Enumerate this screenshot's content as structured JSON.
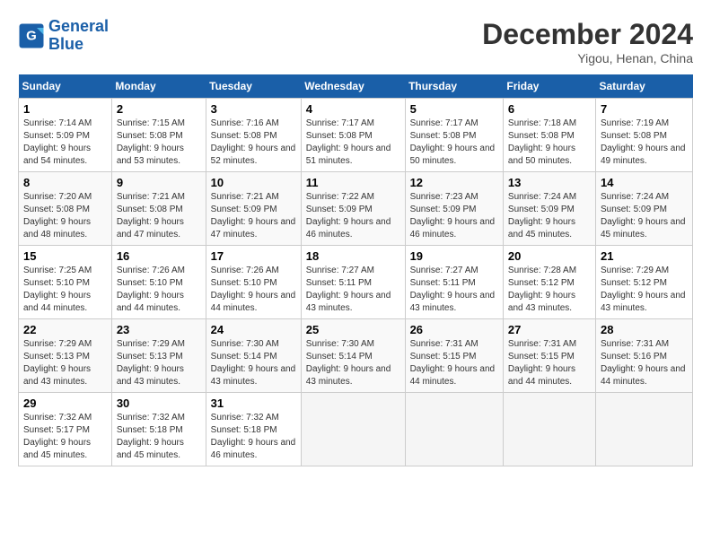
{
  "logo": {
    "text_general": "General",
    "text_blue": "Blue"
  },
  "header": {
    "month": "December 2024",
    "location": "Yigou, Henan, China"
  },
  "weekdays": [
    "Sunday",
    "Monday",
    "Tuesday",
    "Wednesday",
    "Thursday",
    "Friday",
    "Saturday"
  ],
  "weeks": [
    [
      {
        "day": "1",
        "sunrise": "7:14 AM",
        "sunset": "5:09 PM",
        "daylight": "9 hours and 54 minutes."
      },
      {
        "day": "2",
        "sunrise": "7:15 AM",
        "sunset": "5:08 PM",
        "daylight": "9 hours and 53 minutes."
      },
      {
        "day": "3",
        "sunrise": "7:16 AM",
        "sunset": "5:08 PM",
        "daylight": "9 hours and 52 minutes."
      },
      {
        "day": "4",
        "sunrise": "7:17 AM",
        "sunset": "5:08 PM",
        "daylight": "9 hours and 51 minutes."
      },
      {
        "day": "5",
        "sunrise": "7:17 AM",
        "sunset": "5:08 PM",
        "daylight": "9 hours and 50 minutes."
      },
      {
        "day": "6",
        "sunrise": "7:18 AM",
        "sunset": "5:08 PM",
        "daylight": "9 hours and 50 minutes."
      },
      {
        "day": "7",
        "sunrise": "7:19 AM",
        "sunset": "5:08 PM",
        "daylight": "9 hours and 49 minutes."
      }
    ],
    [
      {
        "day": "8",
        "sunrise": "7:20 AM",
        "sunset": "5:08 PM",
        "daylight": "9 hours and 48 minutes."
      },
      {
        "day": "9",
        "sunrise": "7:21 AM",
        "sunset": "5:08 PM",
        "daylight": "9 hours and 47 minutes."
      },
      {
        "day": "10",
        "sunrise": "7:21 AM",
        "sunset": "5:09 PM",
        "daylight": "9 hours and 47 minutes."
      },
      {
        "day": "11",
        "sunrise": "7:22 AM",
        "sunset": "5:09 PM",
        "daylight": "9 hours and 46 minutes."
      },
      {
        "day": "12",
        "sunrise": "7:23 AM",
        "sunset": "5:09 PM",
        "daylight": "9 hours and 46 minutes."
      },
      {
        "day": "13",
        "sunrise": "7:24 AM",
        "sunset": "5:09 PM",
        "daylight": "9 hours and 45 minutes."
      },
      {
        "day": "14",
        "sunrise": "7:24 AM",
        "sunset": "5:09 PM",
        "daylight": "9 hours and 45 minutes."
      }
    ],
    [
      {
        "day": "15",
        "sunrise": "7:25 AM",
        "sunset": "5:10 PM",
        "daylight": "9 hours and 44 minutes."
      },
      {
        "day": "16",
        "sunrise": "7:26 AM",
        "sunset": "5:10 PM",
        "daylight": "9 hours and 44 minutes."
      },
      {
        "day": "17",
        "sunrise": "7:26 AM",
        "sunset": "5:10 PM",
        "daylight": "9 hours and 44 minutes."
      },
      {
        "day": "18",
        "sunrise": "7:27 AM",
        "sunset": "5:11 PM",
        "daylight": "9 hours and 43 minutes."
      },
      {
        "day": "19",
        "sunrise": "7:27 AM",
        "sunset": "5:11 PM",
        "daylight": "9 hours and 43 minutes."
      },
      {
        "day": "20",
        "sunrise": "7:28 AM",
        "sunset": "5:12 PM",
        "daylight": "9 hours and 43 minutes."
      },
      {
        "day": "21",
        "sunrise": "7:29 AM",
        "sunset": "5:12 PM",
        "daylight": "9 hours and 43 minutes."
      }
    ],
    [
      {
        "day": "22",
        "sunrise": "7:29 AM",
        "sunset": "5:13 PM",
        "daylight": "9 hours and 43 minutes."
      },
      {
        "day": "23",
        "sunrise": "7:29 AM",
        "sunset": "5:13 PM",
        "daylight": "9 hours and 43 minutes."
      },
      {
        "day": "24",
        "sunrise": "7:30 AM",
        "sunset": "5:14 PM",
        "daylight": "9 hours and 43 minutes."
      },
      {
        "day": "25",
        "sunrise": "7:30 AM",
        "sunset": "5:14 PM",
        "daylight": "9 hours and 43 minutes."
      },
      {
        "day": "26",
        "sunrise": "7:31 AM",
        "sunset": "5:15 PM",
        "daylight": "9 hours and 44 minutes."
      },
      {
        "day": "27",
        "sunrise": "7:31 AM",
        "sunset": "5:15 PM",
        "daylight": "9 hours and 44 minutes."
      },
      {
        "day": "28",
        "sunrise": "7:31 AM",
        "sunset": "5:16 PM",
        "daylight": "9 hours and 44 minutes."
      }
    ],
    [
      {
        "day": "29",
        "sunrise": "7:32 AM",
        "sunset": "5:17 PM",
        "daylight": "9 hours and 45 minutes."
      },
      {
        "day": "30",
        "sunrise": "7:32 AM",
        "sunset": "5:18 PM",
        "daylight": "9 hours and 45 minutes."
      },
      {
        "day": "31",
        "sunrise": "7:32 AM",
        "sunset": "5:18 PM",
        "daylight": "9 hours and 46 minutes."
      },
      null,
      null,
      null,
      null
    ]
  ]
}
